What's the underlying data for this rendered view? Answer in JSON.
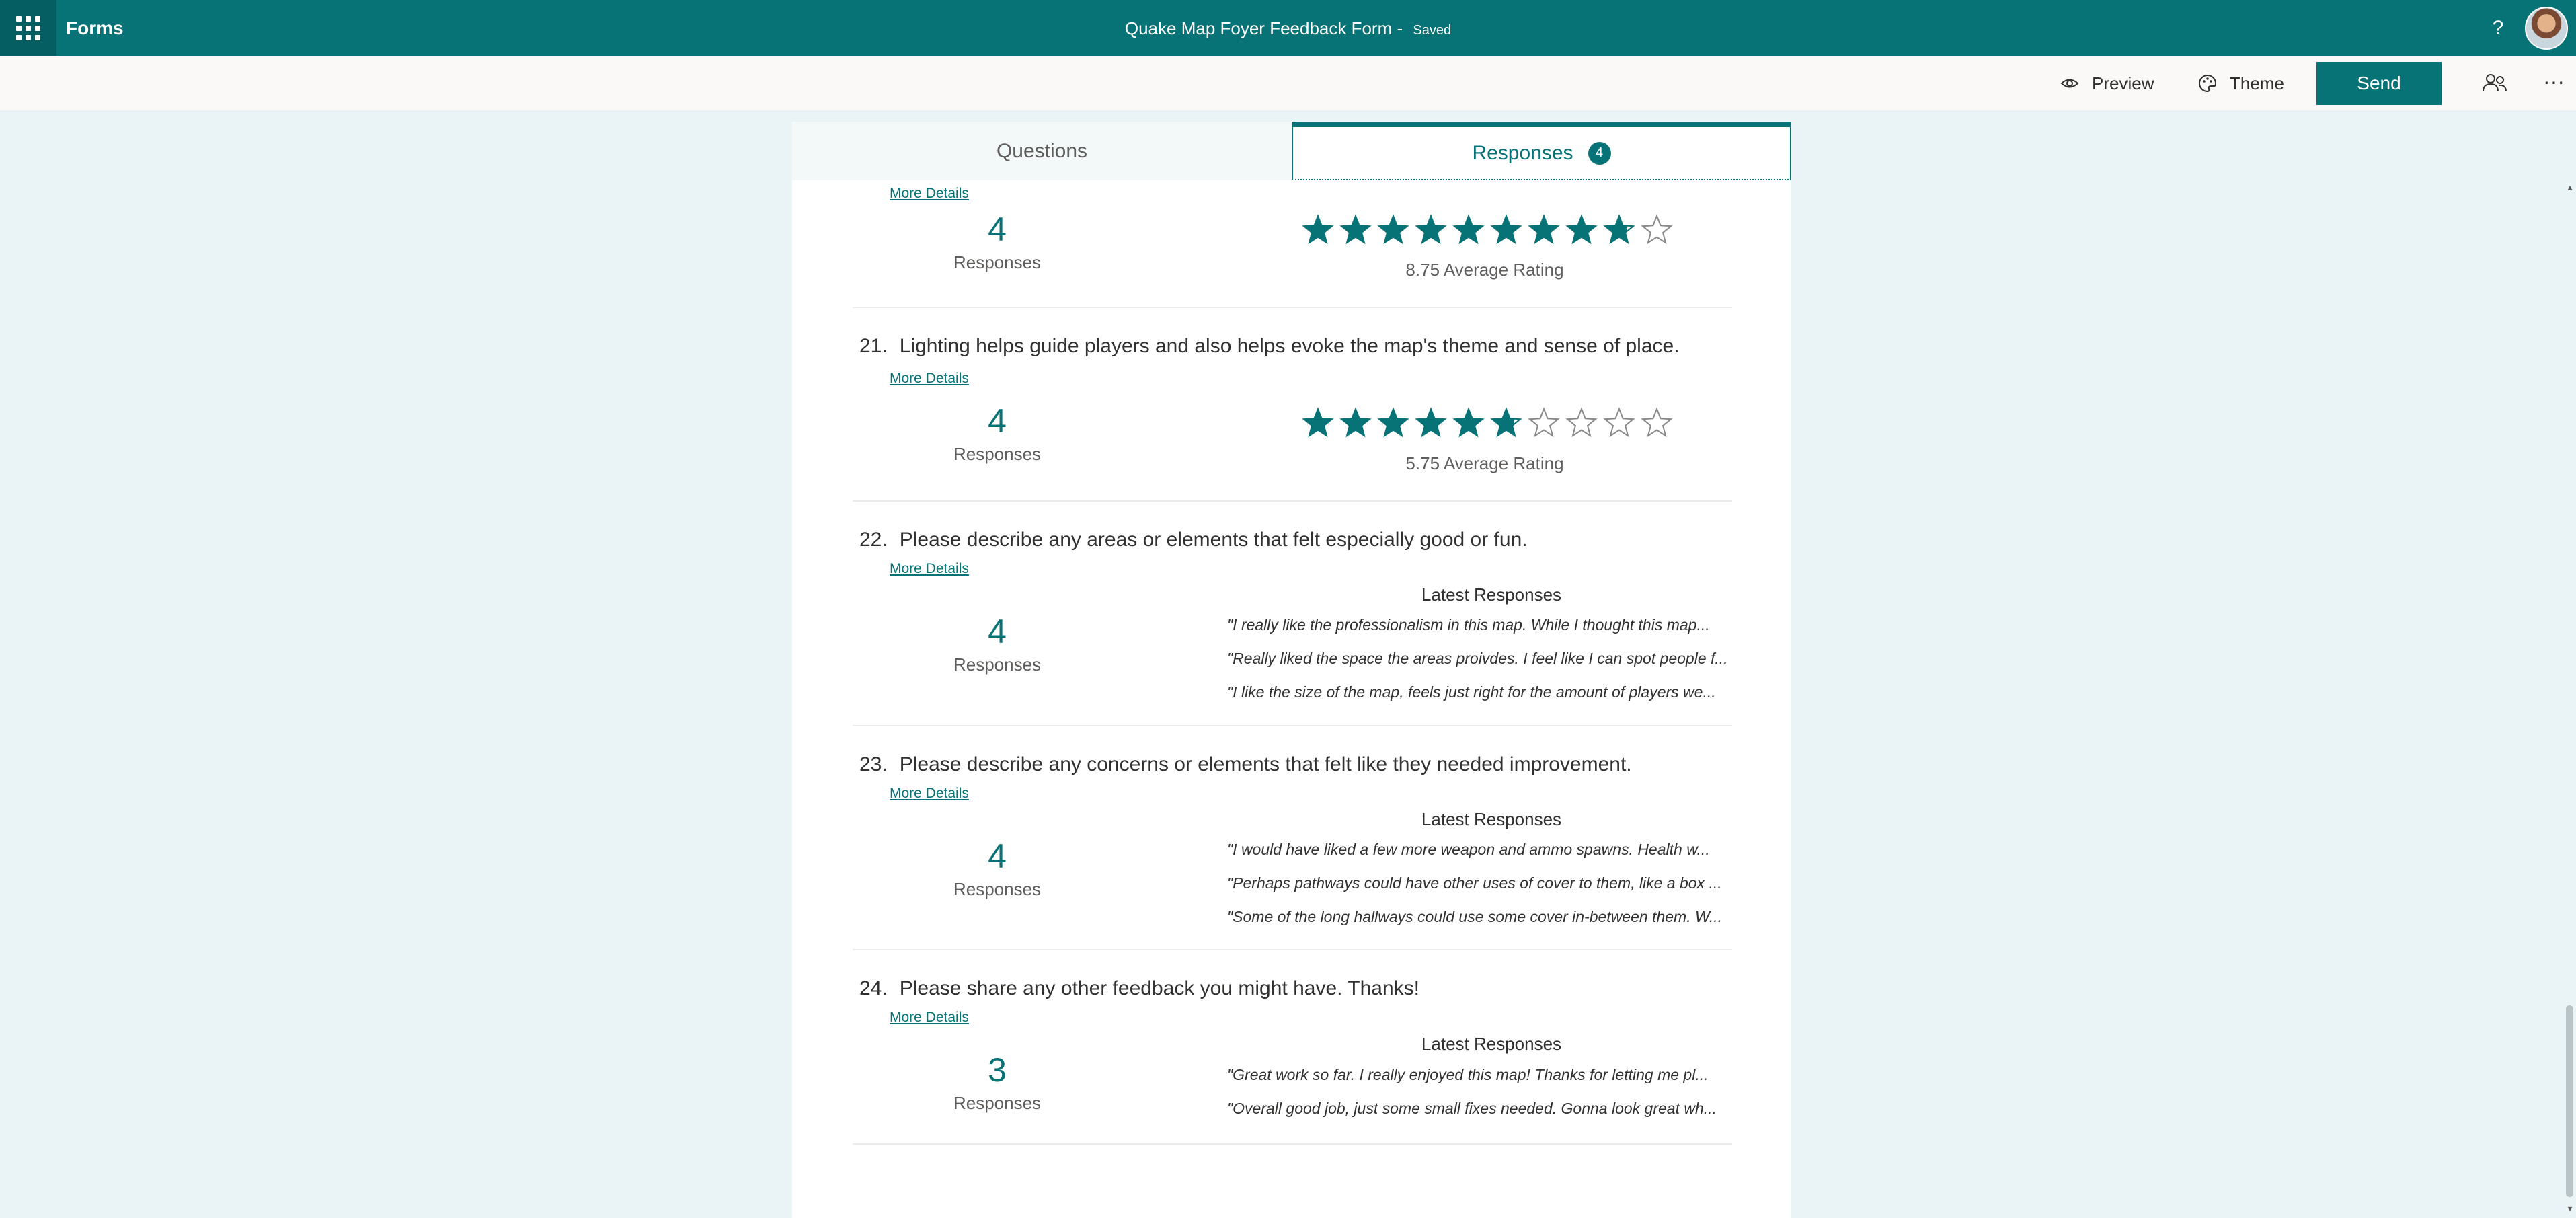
{
  "app": {
    "name": "Forms",
    "title": "Quake Map Foyer Feedback Form",
    "save_status": "Saved"
  },
  "toolbar": {
    "preview": "Preview",
    "theme": "Theme",
    "send": "Send"
  },
  "tabs": {
    "questions": "Questions",
    "responses": "Responses",
    "responses_count": "4"
  },
  "questions": [
    {
      "more_details": "More Details",
      "count": "4",
      "count_label": "Responses",
      "rating": {
        "filled": 8.75,
        "max": 10,
        "label": "8.75 Average Rating"
      }
    },
    {
      "number": "21.",
      "text": "Lighting helps guide players and also helps evoke the map's theme and sense of place.",
      "more_details": "More Details",
      "count": "4",
      "count_label": "Responses",
      "rating": {
        "filled": 5.75,
        "max": 10,
        "label": "5.75 Average Rating"
      }
    },
    {
      "number": "22.",
      "text": "Please describe any areas or elements that felt especially good or fun.",
      "more_details": "More Details",
      "count": "4",
      "count_label": "Responses",
      "latest_header": "Latest Responses",
      "responses": [
        "\"I really like the professionalism in this map. While I thought this map...",
        "\"Really liked the space the areas proivdes. I feel like I can spot people f...",
        "\"I like the size of the map, feels just right for the amount of players we..."
      ]
    },
    {
      "number": "23.",
      "text": "Please describe any concerns or elements that felt like they needed improvement.",
      "more_details": "More Details",
      "count": "4",
      "count_label": "Responses",
      "latest_header": "Latest Responses",
      "responses": [
        "\"I would have liked a few more weapon and ammo spawns. Health w...",
        "\"Perhaps pathways could have other uses of cover to them, like a box ...",
        "\"Some of the long hallways could use some cover in-between them. W..."
      ]
    },
    {
      "number": "24.",
      "text": "Please share any other feedback you might have. Thanks!",
      "more_details": "More Details",
      "count": "3",
      "count_label": "Responses",
      "latest_header": "Latest Responses",
      "responses": [
        "\"Great work so far. I really enjoyed this map! Thanks for letting me pl...",
        "\"Overall good job, just some small fixes needed. Gonna look great wh..."
      ]
    }
  ],
  "colors": {
    "brand": "#077377",
    "star_filled": "#077377",
    "star_empty": "#8a8886"
  }
}
